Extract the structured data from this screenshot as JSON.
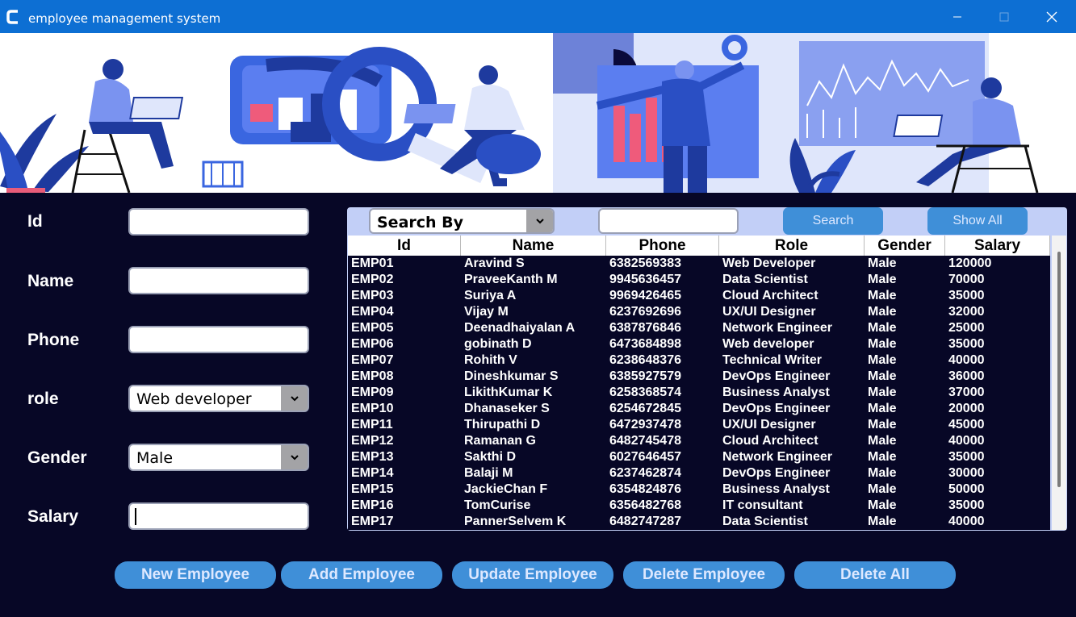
{
  "window": {
    "title": "employee management system",
    "accent": "#0d6fd3",
    "background": "#070726"
  },
  "form": {
    "id_label": "Id",
    "name_label": "Name",
    "phone_label": "Phone",
    "role_label": "role",
    "gender_label": "Gender",
    "salary_label": "Salary",
    "id_value": "",
    "name_value": "",
    "phone_value": "",
    "role_value": "Web developer",
    "gender_value": "Male",
    "salary_value": ""
  },
  "search": {
    "search_by_label": "Search By",
    "search_text": "",
    "search_button": "Search",
    "show_all_button": "Show All"
  },
  "table": {
    "columns": [
      "Id",
      "Name",
      "Phone",
      "Role",
      "Gender",
      "Salary"
    ],
    "rows": [
      [
        "EMP01",
        "Aravind S",
        "6382569383",
        "Web Developer",
        "Male",
        "120000"
      ],
      [
        "EMP02",
        "PraveeKanth M",
        "9945636457",
        "Data Scientist",
        "Male",
        "70000"
      ],
      [
        "EMP03",
        "Suriya A",
        "9969426465",
        "Cloud Architect",
        "Male",
        "35000"
      ],
      [
        "EMP04",
        "Vijay M",
        "6237692696",
        "UX/UI Designer",
        "Male",
        "32000"
      ],
      [
        "EMP05",
        "Deenadhaiyalan A",
        "6387876846",
        "Network Engineer",
        "Male",
        "25000"
      ],
      [
        "EMP06",
        "gobinath D",
        "6473684898",
        "Web developer",
        "Male",
        "35000"
      ],
      [
        "EMP07",
        "Rohith V",
        "6238648376",
        "Technical Writer",
        "Male",
        "40000"
      ],
      [
        "EMP08",
        "Dineshkumar S",
        "6385927579",
        "DevOps Engineer",
        "Male",
        "36000"
      ],
      [
        "EMP09",
        "LikithKumar K",
        "6258368574",
        "Business Analyst",
        "Male",
        "37000"
      ],
      [
        "EMP10",
        "Dhanaseker S",
        "6254672845",
        "DevOps Engineer",
        "Male",
        "20000"
      ],
      [
        "EMP11",
        "Thirupathi D",
        "6472937478",
        "UX/UI Designer",
        "Male",
        "45000"
      ],
      [
        "EMP12",
        "Ramanan G",
        "6482745478",
        "Cloud Architect",
        "Male",
        "40000"
      ],
      [
        "EMP13",
        "Sakthi D",
        "6027646457",
        "Network Engineer",
        "Male",
        "35000"
      ],
      [
        "EMP14",
        "Balaji M",
        "6237462874",
        "DevOps Engineer",
        "Male",
        "30000"
      ],
      [
        "EMP15",
        "JackieChan F",
        "6354824876",
        "Business Analyst",
        "Male",
        "50000"
      ],
      [
        "EMP16",
        "TomCurise",
        "6356482768",
        "IT consultant",
        "Male",
        "35000"
      ],
      [
        "EMP17",
        "PannerSelvem K",
        "6482747287",
        "Data Scientist",
        "Male",
        "40000"
      ]
    ]
  },
  "actions": {
    "new_employee": "New Employee",
    "add_employee": "Add Employee",
    "update_employee": "Update Employee",
    "delete_employee": "Delete Employee",
    "delete_all": "Delete All"
  }
}
